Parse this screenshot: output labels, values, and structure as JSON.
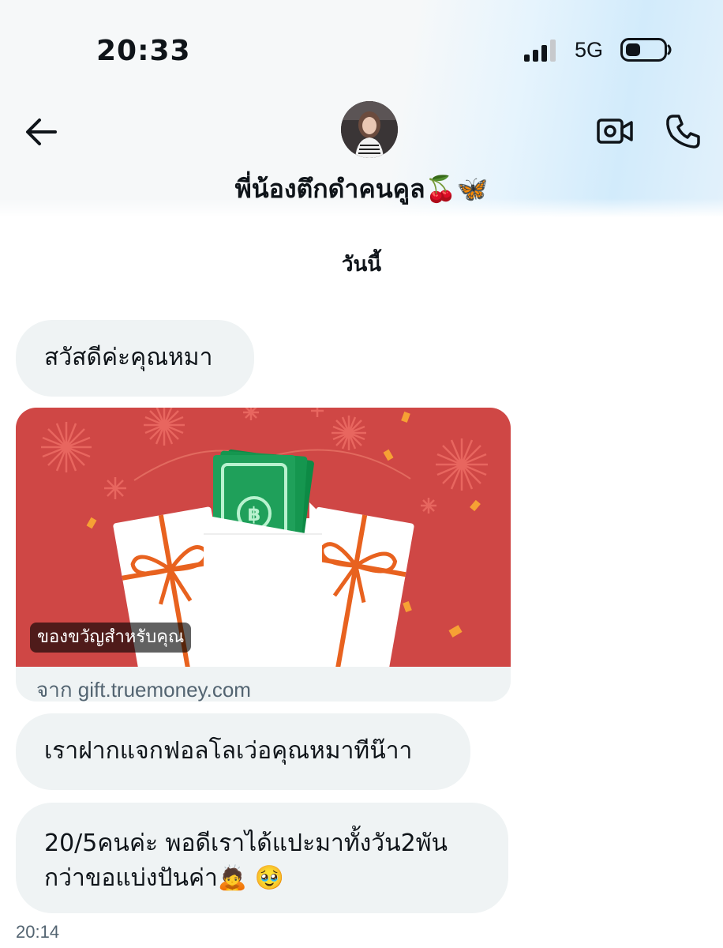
{
  "status_bar": {
    "time": "20:33",
    "network": "5G",
    "battery_icon": "battery-low-icon",
    "signal_icon": "cellular-signal-icon"
  },
  "header": {
    "back_icon": "arrow-left-icon",
    "contact_name": "พี่น้องตึกดำคนคูล🍒🦋",
    "video_icon": "video-camera-icon",
    "call_icon": "phone-icon"
  },
  "date_separator": "วันนี้",
  "messages": [
    {
      "type": "text",
      "text": "สวัสดีค่ะคุณหมา"
    },
    {
      "type": "link_card",
      "badge": "ของขวัญสำหรับคุณ",
      "source": "จาก gift.truemoney.com"
    },
    {
      "type": "text",
      "text": "เราฝากแจกฟอลโลเว่อคุณหมาทีน๊าา"
    },
    {
      "type": "text",
      "line1": "20/5คนค่ะ พอดีเราได้แปะมาทั้งวัน2พัน",
      "line2": "กว่าขอแบ่งปันค่า🙇 🥹"
    }
  ],
  "timestamp": "20:14",
  "colors": {
    "bubble": "#eff3f4",
    "card_red": "#cf4745",
    "money_green": "#1fa05a",
    "ribbon": "#e8621f"
  }
}
